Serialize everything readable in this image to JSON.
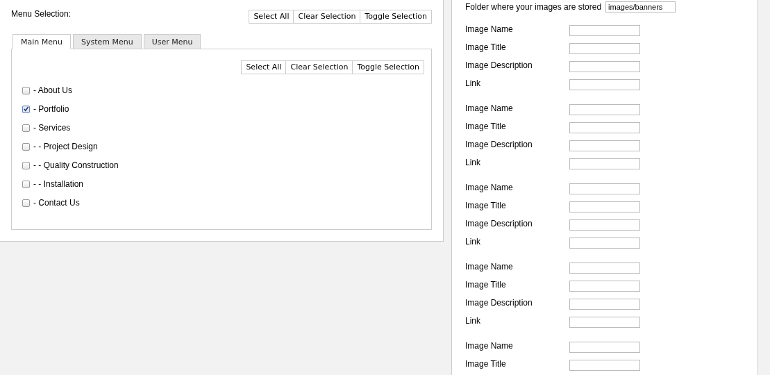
{
  "menu_selection": {
    "label": "Menu Selection:",
    "buttons": [
      "Select All",
      "Clear Selection",
      "Toggle Selection"
    ]
  },
  "tabs": [
    {
      "label": "Main Menu",
      "selected": true
    },
    {
      "label": "System Menu",
      "selected": false
    },
    {
      "label": "User Menu",
      "selected": false
    }
  ],
  "tab_panel": {
    "buttons": [
      "Select All",
      "Clear Selection",
      "Toggle Selection"
    ],
    "items": [
      {
        "label": "- About Us",
        "checked": false
      },
      {
        "label": "- Portfolio",
        "checked": true
      },
      {
        "label": "- Services",
        "checked": false
      },
      {
        "label": "- - Project Design",
        "checked": false
      },
      {
        "label": "- - Quality Construction",
        "checked": false
      },
      {
        "label": "- - Installation",
        "checked": false
      },
      {
        "label": "- Contact Us",
        "checked": false
      }
    ]
  },
  "image_settings": {
    "folder": {
      "label": "Folder where your images are stored",
      "value": "images/banners"
    },
    "groups": [
      {
        "fields": [
          "Image Name",
          "Image Title",
          "Image Description",
          "Link"
        ]
      },
      {
        "fields": [
          "Image Name",
          "Image Title",
          "Image Description",
          "Link"
        ]
      },
      {
        "fields": [
          "Image Name",
          "Image Title",
          "Image Description",
          "Link"
        ]
      },
      {
        "fields": [
          "Image Name",
          "Image Title",
          "Image Description",
          "Link"
        ]
      },
      {
        "fields": [
          "Image Name",
          "Image Title"
        ]
      }
    ]
  }
}
